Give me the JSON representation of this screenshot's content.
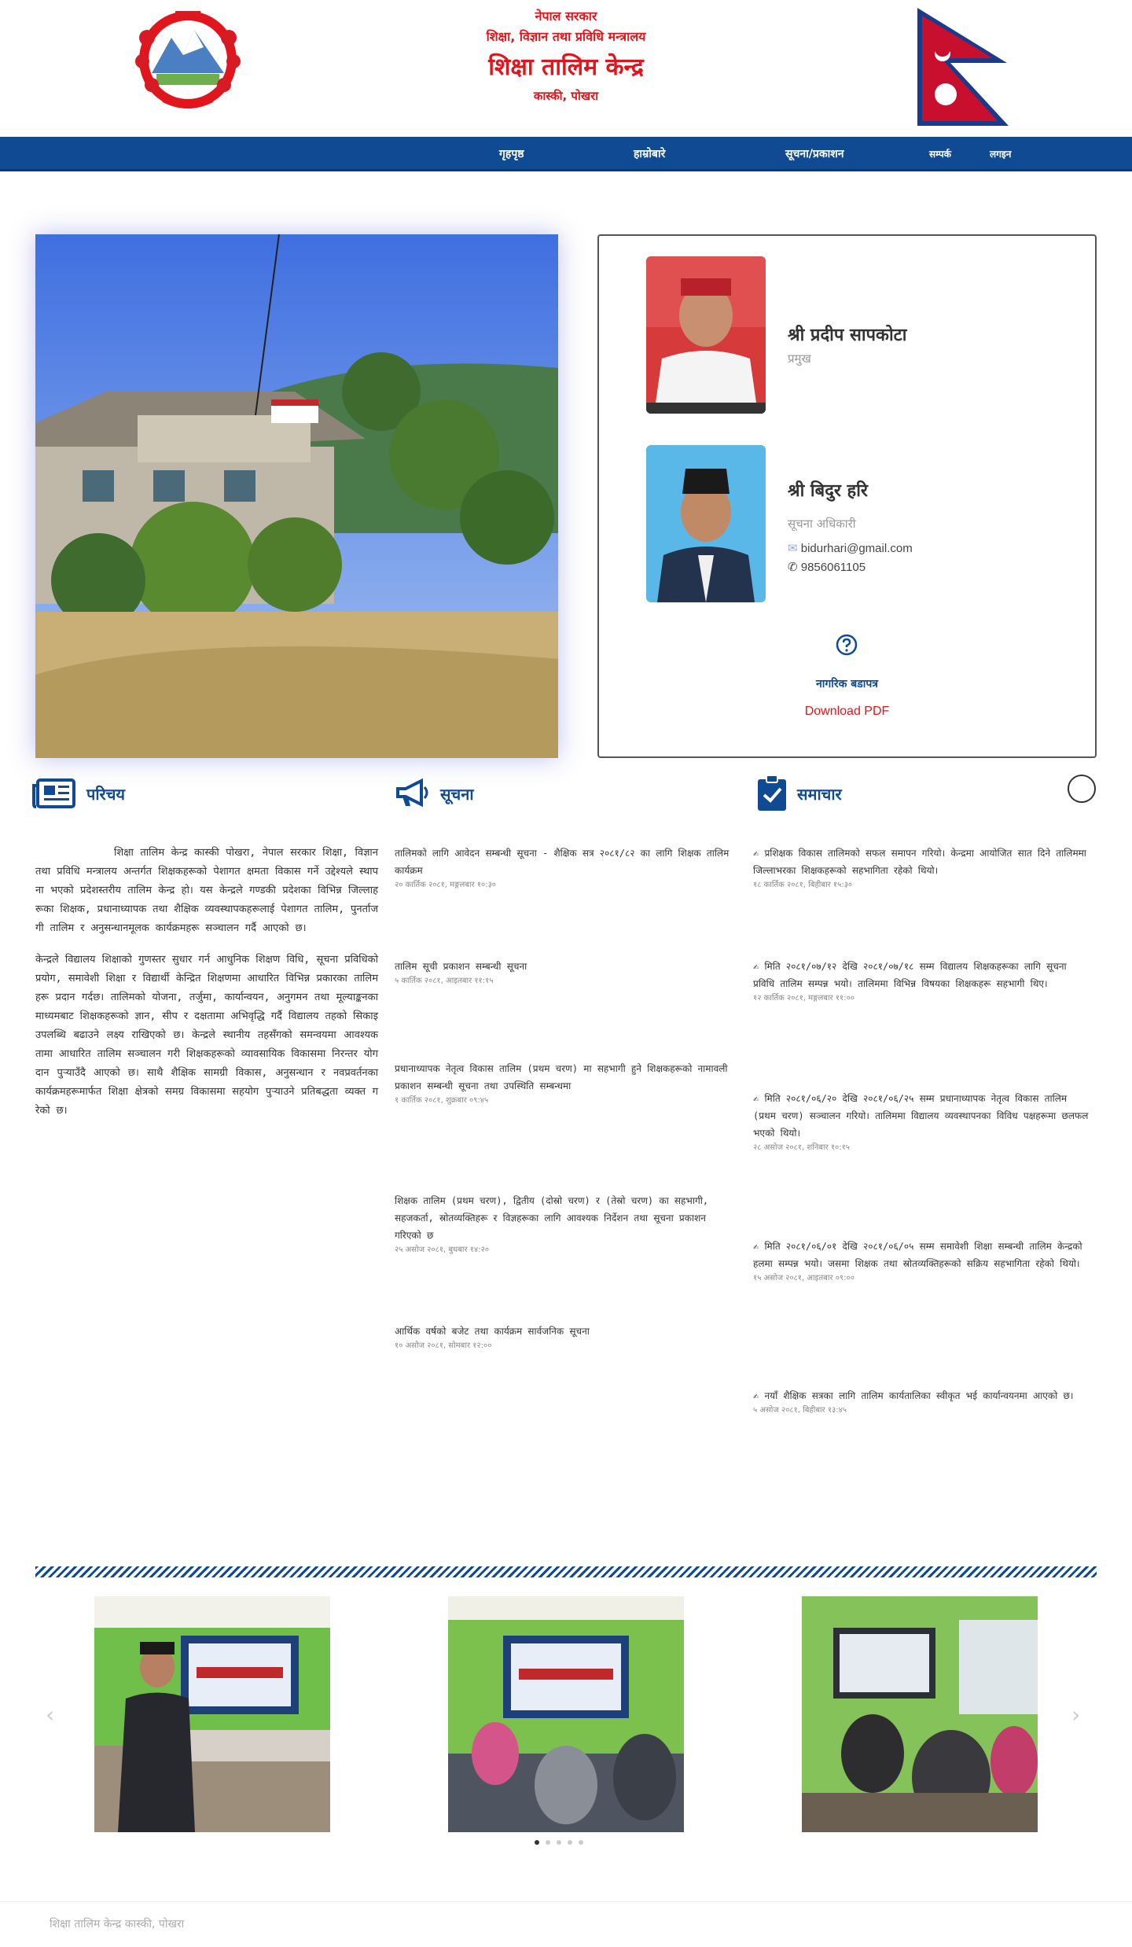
{
  "header": {
    "line1": "नेपाल सरकार",
    "line2": "शिक्षा, विज्ञान तथा प्रविधि मन्त्रालय",
    "title": "शिक्षा तालिम केन्द्र",
    "location": "कास्की, पोखरा"
  },
  "nav": [
    "गृहपृष्ठ",
    "हाम्रोबारे",
    "सूचना/प्रकाशन",
    "सम्पर्क",
    "लगइन"
  ],
  "officials": [
    {
      "name": "श्री प्रदीप सापकोटा",
      "title": "प्रमुख"
    },
    {
      "name": "श्री बिदुर हरि",
      "title": "सूचना अधिकारी",
      "email": "bidurhari@gmail.com",
      "phone": "9856061105"
    }
  ],
  "icons": {
    "email": "✉",
    "phone": "✆"
  },
  "citizen_charter": "नागरिक बडापत्र",
  "download": "Download PDF",
  "sections": {
    "intro": "परिचय",
    "notices": "सूचना",
    "news": "समाचार"
  },
  "intro_paragraphs": [
    "शिक्षा तालिम केन्द्र कास्की पोखरा, नेपाल सरकार शिक्षा, विज्ञान तथा प्रविधि मन्त्रालय अन्तर्गत शिक्षकहरूको पेशागत क्षमता विकास गर्ने उद्देश्यले स्थापना भएको प्रदेशस्तरीय तालिम केन्द्र हो। यस केन्द्रले गण्डकी प्रदेशका विभिन्न जिल्लाहरूका शिक्षक, प्रधानाध्यापक तथा शैक्षिक व्यवस्थापकहरूलाई पेशागत तालिम, पुनर्ताजगी तालिम र अनुसन्धानमूलक कार्यक्रमहरू सञ्चालन गर्दै आएको छ।",
    "केन्द्रले विद्यालय शिक्षाको गुणस्तर सुधार गर्न आधुनिक शिक्षण विधि, सूचना प्रविधिको प्रयोग, समावेशी शिक्षा र विद्यार्थी केन्द्रित शिक्षणमा आधारित विभिन्न प्रकारका तालिमहरू प्रदान गर्दछ। तालिमको योजना, तर्जुमा, कार्यान्वयन, अनुगमन तथा मूल्याङ्कनका माध्यमबाट शिक्षकहरूको ज्ञान, सीप र दक्षतामा अभिवृद्धि गर्दै विद्यालय तहको सिकाइ उपलब्धि बढाउने लक्ष्य राखिएको छ। केन्द्रले स्थानीय तहसँगको समन्वयमा आवश्यकतामा आधारित तालिम सञ्चालन गरी शिक्षकहरूको व्यावसायिक विकासमा निरन्तर योगदान पुर्‍याउँदै आएको छ। साथै शैक्षिक सामग्री विकास, अनुसन्धान र नवप्रवर्तनका कार्यक्रमहरूमार्फत शिक्षा क्षेत्रको समग्र विकासमा सहयोग पुर्‍याउने प्रतिबद्धता व्यक्त गरेको छ।"
  ],
  "notices": [
    {
      "text": "तालिमको लागि आवेदन सम्बन्धी सूचना - शैक्षिक सत्र २०८१/८२ का लागि शिक्षक तालिम कार्यक्रम",
      "date": "२० कार्तिक २०८१, मङ्गलबार १०:३०"
    },
    {
      "text": "तालिम सूची प्रकाशन सम्बन्धी सूचना",
      "date": "५ कार्तिक २०८१, आइतबार ११:१५"
    },
    {
      "text": "प्रधानाध्यापक नेतृत्व विकास तालिम (प्रथम चरण) मा सहभागी हुने शिक्षकहरूको नामावली प्रकाशन सम्बन्धी सूचना तथा उपस्थिति सम्बन्धमा",
      "date": "१ कार्तिक २०८१, शुक्रबार ०९:४५"
    },
    {
      "text": "शिक्षक तालिम (प्रथम चरण), द्वितीय (दोस्रो चरण) र (तेस्रो चरण) का सहभागी, सहजकर्ता, स्रोतव्यक्तिहरू र विज्ञहरूका लागि आवश्यक निर्देशन तथा सूचना प्रकाशन गरिएको छ",
      "date": "२५ असोज २०८१, बुधबार १४:२०"
    },
    {
      "text": "आर्थिक वर्षको बजेट तथा कार्यक्रम सार्वजनिक सूचना",
      "date": "१० असोज २०८१, सोमबार १२:००"
    }
  ],
  "news": [
    {
      "text": "✍ प्रशिक्षक विकास तालिमको सफल समापन गरियो। केन्द्रमा आयोजित सात दिने तालिममा जिल्लाभरका शिक्षकहरूको सहभागिता रहेको थियो।",
      "date": "१८ कार्तिक २०८१, बिहीबार १५:३०"
    },
    {
      "text": "✍ मिति २०८१/०७/१२ देखि २०८१/०७/१८ सम्म विद्यालय शिक्षकहरूका लागि सूचना प्रविधि तालिम सम्पन्न भयो। तालिममा विभिन्न विषयका शिक्षकहरू सहभागी थिए।",
      "date": "१२ कार्तिक २०८१, मङ्गलबार ११:००"
    },
    {
      "text": "✍ मिति २०८१/०६/२० देखि २०८१/०६/२५ सम्म प्रधानाध्यापक नेतृत्व विकास तालिम (प्रथम चरण) सञ्चालन गरियो। तालिममा विद्यालय व्यवस्थापनका विविध पक्षहरूमा छलफल भएको थियो।",
      "date": "२८ असोज २०८१, शनिबार १०:१५"
    },
    {
      "text": "✍ मिति २०८१/०६/०१ देखि २०८१/०६/०५ सम्म समावेशी शिक्षा सम्बन्धी तालिम केन्द्रको हलमा सम्पन्न भयो। जसमा शिक्षक तथा स्रोतव्यक्तिहरूको सक्रिय सहभागिता रहेको थियो।",
      "date": "१५ असोज २०८१, आइतबार ०९:००"
    },
    {
      "text": "✍ नयाँ शैक्षिक सत्रका लागि तालिम कार्यतालिका स्वीकृत भई कार्यान्वयनमा आएको छ।",
      "date": "५ असोज २०८१, बिहीबार १३:४५"
    }
  ],
  "footer": "शिक्षा तालिम केन्द्र कास्की, पोखरा",
  "colors": {
    "primary": "#0f4a93",
    "accent": "#e0161c"
  }
}
